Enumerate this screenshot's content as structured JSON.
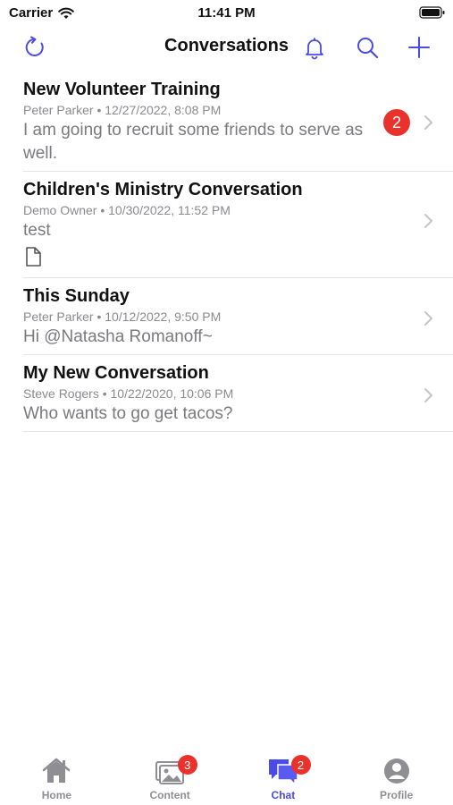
{
  "status_bar": {
    "carrier": "Carrier",
    "time": "11:41 PM"
  },
  "nav": {
    "title": "Conversations"
  },
  "accent_color": "#4a4ae6",
  "conversations": [
    {
      "title": "New Volunteer Training",
      "meta": "Peter Parker • 12/27/2022, 8:08 PM",
      "message": "I am going to recruit some friends to serve as well.",
      "badge": "2"
    },
    {
      "title": "Children's Ministry Conversation",
      "meta": "Demo Owner • 10/30/2022, 11:52 PM",
      "message": "test",
      "attachment_icon": "document-icon"
    },
    {
      "title": "This Sunday",
      "meta": "Peter Parker • 10/12/2022, 9:50 PM",
      "message": "Hi @Natasha Romanoff~"
    },
    {
      "title": "My New Conversation",
      "meta": "Steve Rogers • 10/22/2020, 10:06 PM",
      "message": "Who wants to go get tacos?"
    }
  ],
  "tabs": [
    {
      "label": "Home",
      "icon": "home-icon"
    },
    {
      "label": "Content",
      "icon": "content-icon",
      "badge": "3"
    },
    {
      "label": "Chat",
      "icon": "chat-icon",
      "badge": "2",
      "active": true
    },
    {
      "label": "Profile",
      "icon": "profile-icon"
    }
  ]
}
